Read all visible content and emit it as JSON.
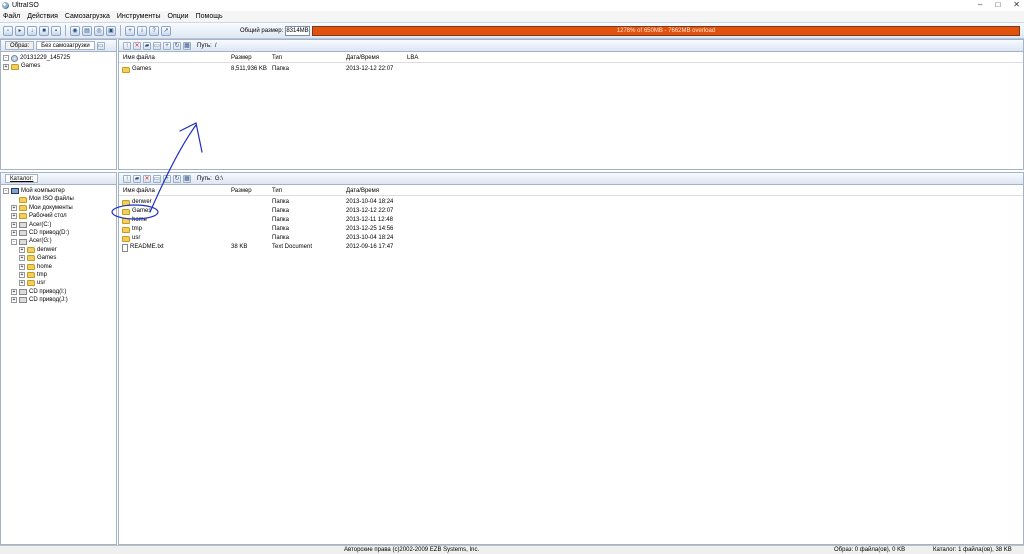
{
  "window": {
    "title": "UltraISO"
  },
  "menu": [
    "Файл",
    "Действия",
    "Самозагрузка",
    "Инструменты",
    "Опции",
    "Помощь"
  ],
  "toolbar": {
    "size_label": "Общий размер:",
    "size_value": "8314MB",
    "progress_text": "1278% of 650MB - 7662MB overload",
    "progress_fraction": 1.0,
    "progress_color": "#e2520d"
  },
  "image_pane": {
    "tab_image": "Образ:",
    "tab_boot": "Без самозагрузки",
    "tree": [
      {
        "label": "20131229_145725",
        "icon": "disc-icon",
        "expander": "-"
      },
      {
        "label": "Games",
        "icon": "folder-icon",
        "expander": "+"
      }
    ]
  },
  "image_files": {
    "path_label": "Путь:",
    "path_value": "/",
    "columns": [
      "Имя файла",
      "Размер",
      "Тип",
      "Дата/Время",
      "LBA"
    ],
    "rows": [
      {
        "name": "Games",
        "size": "8,511,936 KB",
        "type": "Папка",
        "date": "2013-12-12 22:07",
        "lba": ""
      }
    ]
  },
  "catalog_pane": {
    "title": "Каталог:",
    "tree": [
      {
        "label": "Мой компьютер",
        "icon": "computer-icon",
        "expander": "-",
        "level": 0
      },
      {
        "label": "Мои ISO файлы",
        "icon": "folder-icon",
        "expander": "",
        "level": 1
      },
      {
        "label": "Мои документы",
        "icon": "folder-icon",
        "expander": "+",
        "level": 1
      },
      {
        "label": "Рабочий стол",
        "icon": "folder-icon",
        "expander": "+",
        "level": 1
      },
      {
        "label": "Acer(C:)",
        "icon": "drive-icon",
        "expander": "+",
        "level": 1
      },
      {
        "label": "CD привод(D:)",
        "icon": "drive-icon",
        "expander": "+",
        "level": 1
      },
      {
        "label": "Acer(G:)",
        "icon": "drive-icon",
        "expander": "-",
        "level": 1
      },
      {
        "label": "denwer",
        "icon": "folder-icon",
        "expander": "+",
        "level": 2
      },
      {
        "label": "Games",
        "icon": "folder-icon",
        "expander": "+",
        "level": 2
      },
      {
        "label": "home",
        "icon": "folder-icon",
        "expander": "+",
        "level": 2
      },
      {
        "label": "tmp",
        "icon": "folder-icon",
        "expander": "+",
        "level": 2
      },
      {
        "label": "usr",
        "icon": "folder-icon",
        "expander": "+",
        "level": 2
      },
      {
        "label": "CD привод(I:)",
        "icon": "drive-icon",
        "expander": "+",
        "level": 1
      },
      {
        "label": "CD привод(J:)",
        "icon": "drive-icon",
        "expander": "+",
        "level": 1
      }
    ]
  },
  "local_files": {
    "path_label": "Путь:",
    "path_value": "G:\\",
    "columns": [
      "Имя файла",
      "Размер",
      "Тип",
      "Дата/Время"
    ],
    "rows": [
      {
        "name": "denwer",
        "size": "",
        "type": "Папка",
        "date": "2013-10-04 18:24",
        "icon": "folder-icon"
      },
      {
        "name": "Games",
        "size": "",
        "type": "Папка",
        "date": "2013-12-12 22:07",
        "icon": "folder-icon"
      },
      {
        "name": "home",
        "size": "",
        "type": "Папка",
        "date": "2013-12-11 12:48",
        "icon": "folder-icon"
      },
      {
        "name": "tmp",
        "size": "",
        "type": "Папка",
        "date": "2013-12-25 14:56",
        "icon": "folder-icon"
      },
      {
        "name": "usr",
        "size": "",
        "type": "Папка",
        "date": "2013-10-04 18:24",
        "icon": "folder-icon"
      },
      {
        "name": "README.txt",
        "size": "38 KB",
        "type": "Text Document",
        "date": "2012-09-16 17:47",
        "icon": "document-icon"
      }
    ]
  },
  "status": {
    "copyright": "Авторские права (c)2002-2009 EZB Systems, Inc.",
    "image_info": "Образ: 0 файла(ов), 0 KB",
    "catalog_info": "Каталог: 1 файла(ов), 38 KB"
  },
  "annotation_color": "#1f2fc0"
}
